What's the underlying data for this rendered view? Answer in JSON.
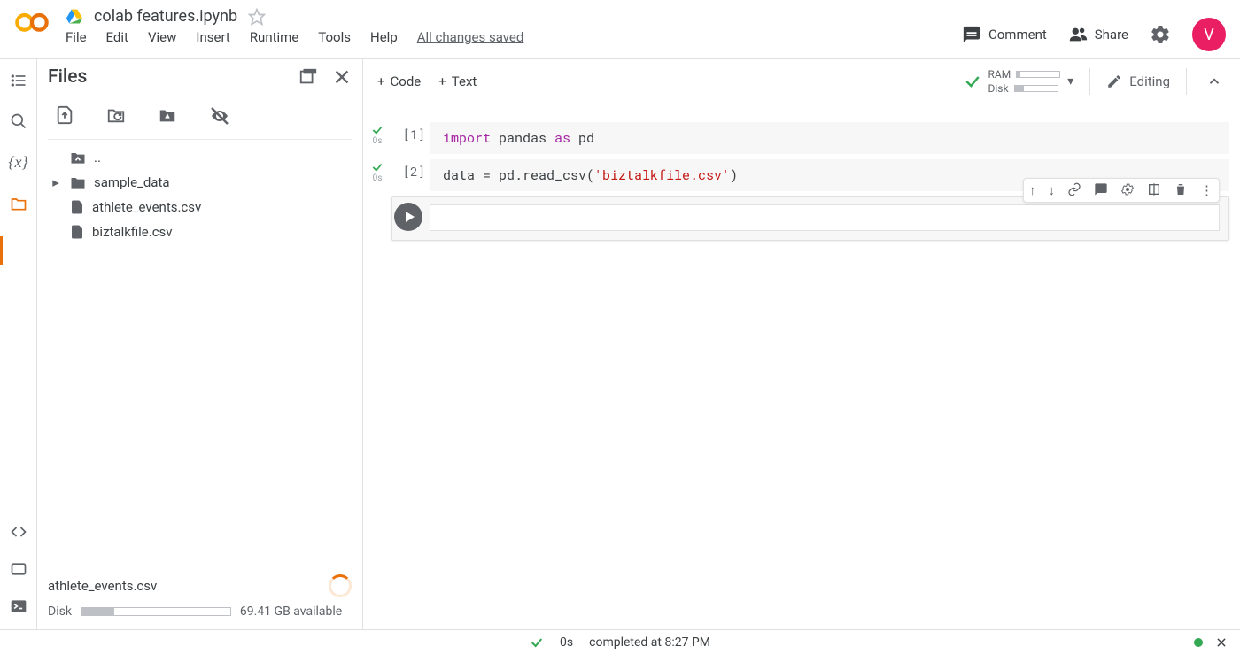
{
  "header": {
    "doc_title": "colab features.ipynb",
    "menu": [
      "File",
      "Edit",
      "View",
      "Insert",
      "Runtime",
      "Tools",
      "Help"
    ],
    "saved": "All changes saved",
    "comment": "Comment",
    "share": "Share",
    "avatar": "V"
  },
  "main_toolbar": {
    "add_code": "Code",
    "add_text": "Text",
    "ram_label": "RAM",
    "disk_label": "Disk",
    "editing": "Editing"
  },
  "files": {
    "title": "Files",
    "items": [
      {
        "type": "up",
        "label": ".."
      },
      {
        "type": "folder",
        "label": "sample_data"
      },
      {
        "type": "file",
        "label": "athlete_events.csv"
      },
      {
        "type": "file",
        "label": "biztalkfile.csv"
      }
    ],
    "uploading": "athlete_events.csv",
    "disk_label": "Disk",
    "disk_available": "69.41 GB available"
  },
  "cells": [
    {
      "idx": "[1]",
      "time": "0s",
      "tokens": [
        {
          "t": "import ",
          "c": "kw-purple"
        },
        {
          "t": "pandas ",
          "c": "kw-black"
        },
        {
          "t": "as ",
          "c": "kw-purple"
        },
        {
          "t": "pd",
          "c": "kw-black"
        }
      ]
    },
    {
      "idx": "[2]",
      "time": "0s",
      "tokens": [
        {
          "t": "data = pd.read_csv(",
          "c": "kw-black"
        },
        {
          "t": "'biztalkfile.csv'",
          "c": "kw-str"
        },
        {
          "t": ")",
          "c": "kw-black"
        }
      ]
    }
  ],
  "status": {
    "time": "0s",
    "completed": "completed at 8:27 PM"
  }
}
